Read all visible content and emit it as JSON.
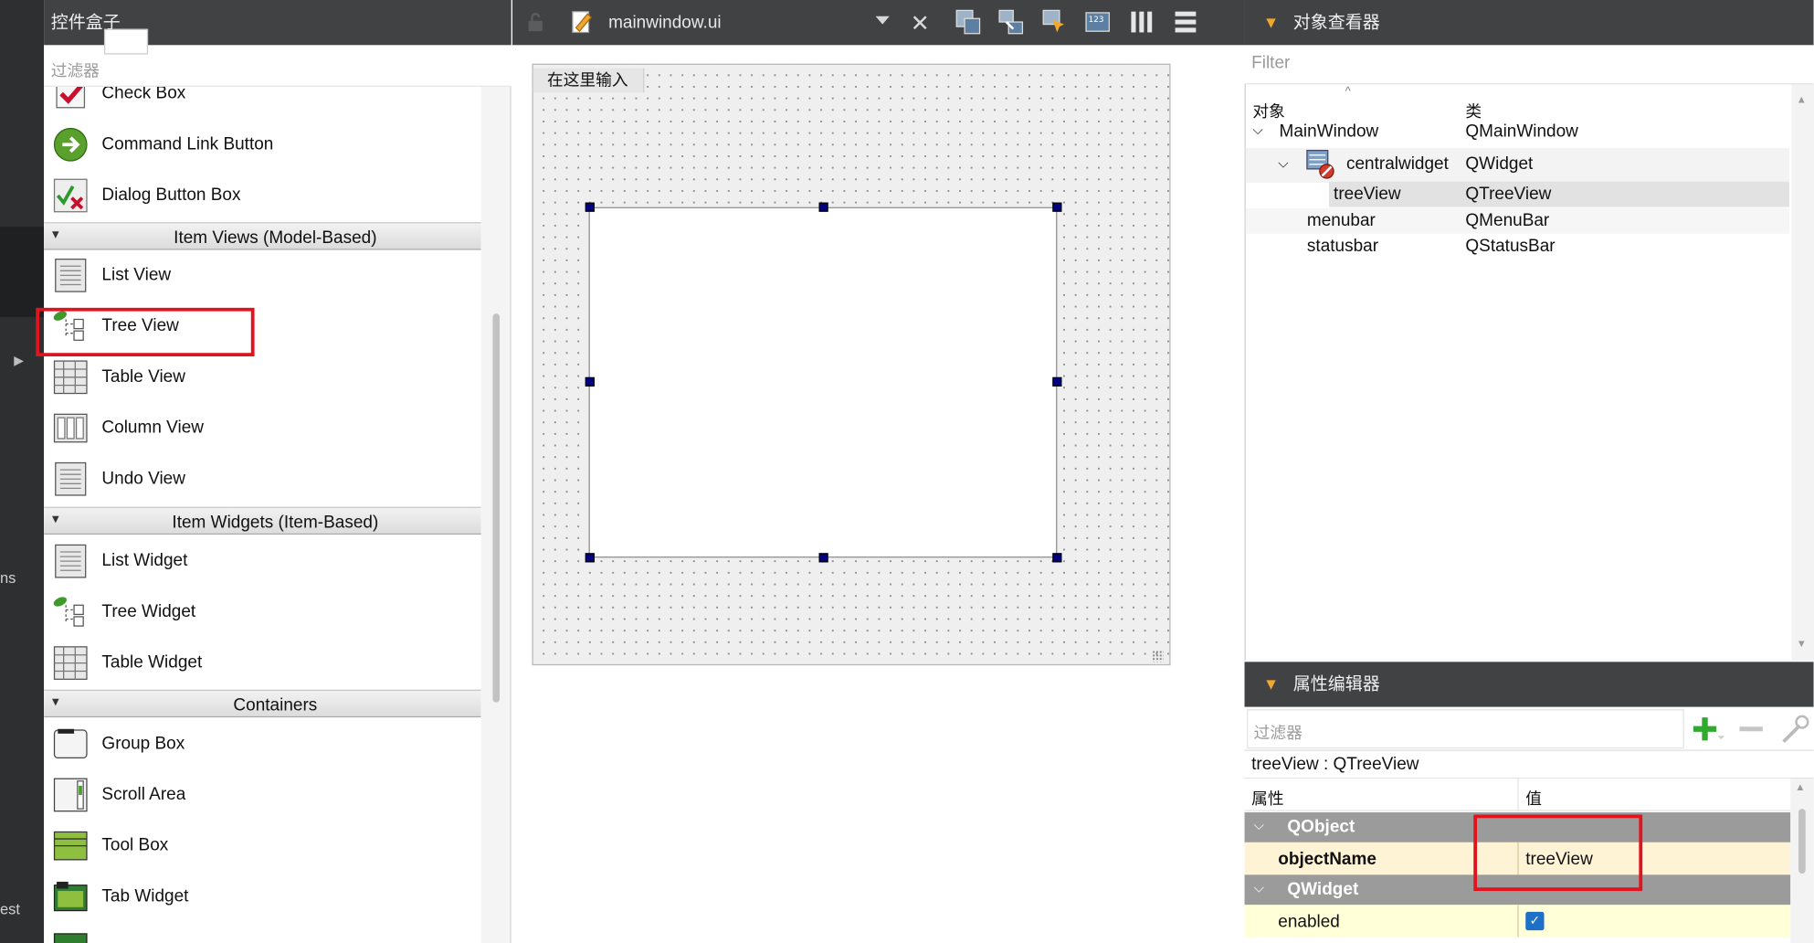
{
  "modebar": {
    "labels": [
      "ns",
      "est"
    ]
  },
  "widget_box": {
    "title": "控件盒子",
    "filter_placeholder": "过滤器",
    "items": [
      {
        "label": "Check Box",
        "icon": "checkbox-icon"
      },
      {
        "label": "Command Link Button",
        "icon": "command-link-icon"
      },
      {
        "label": "Dialog Button Box",
        "icon": "dialog-button-box-icon"
      },
      {
        "label": "List View",
        "icon": "list-view-icon"
      },
      {
        "label": "Tree View",
        "icon": "tree-view-icon"
      },
      {
        "label": "Table View",
        "icon": "table-view-icon"
      },
      {
        "label": "Column View",
        "icon": "column-view-icon"
      },
      {
        "label": "Undo View",
        "icon": "undo-view-icon"
      },
      {
        "label": "List Widget",
        "icon": "list-widget-icon"
      },
      {
        "label": "Tree Widget",
        "icon": "tree-widget-icon"
      },
      {
        "label": "Table Widget",
        "icon": "table-widget-icon"
      },
      {
        "label": "Group Box",
        "icon": "group-box-icon"
      },
      {
        "label": "Scroll Area",
        "icon": "scroll-area-icon"
      },
      {
        "label": "Tool Box",
        "icon": "tool-box-icon"
      },
      {
        "label": "Tab Widget",
        "icon": "tab-widget-icon"
      }
    ],
    "categories": [
      "Item Views (Model-Based)",
      "Item Widgets (Item-Based)",
      "Containers"
    ]
  },
  "editor": {
    "file_name": "mainwindow.ui",
    "menu_placeholder": "在这里输入",
    "toolbar_icons": [
      "edit-widgets-icon",
      "edit-signals-icon",
      "edit-buddies-icon",
      "edit-tab-order-icon",
      "layout-horizontal-icon",
      "layout-vertical-icon"
    ]
  },
  "object_inspector": {
    "title": "对象查看器",
    "filter_placeholder": "Filter",
    "col_object": "对象",
    "col_class": "类",
    "rows": [
      {
        "object": "MainWindow",
        "class": "QMainWindow"
      },
      {
        "object": "centralwidget",
        "class": "QWidget"
      },
      {
        "object": "treeView",
        "class": "QTreeView"
      },
      {
        "object": "menubar",
        "class": "QMenuBar"
      },
      {
        "object": "statusbar",
        "class": "QStatusBar"
      }
    ]
  },
  "property_editor": {
    "title": "属性编辑器",
    "filter_placeholder": "过滤器",
    "selected_class": "treeView : QTreeView",
    "col_property": "属性",
    "col_value": "值",
    "groups": [
      "QObject",
      "QWidget"
    ],
    "props": [
      {
        "name": "objectName",
        "value": "treeView"
      },
      {
        "name": "enabled",
        "value": ""
      }
    ]
  },
  "colors": {
    "highlight": "#e0141e",
    "accent": "#f0a72e",
    "dark": "#404244",
    "selection": "#000080"
  }
}
